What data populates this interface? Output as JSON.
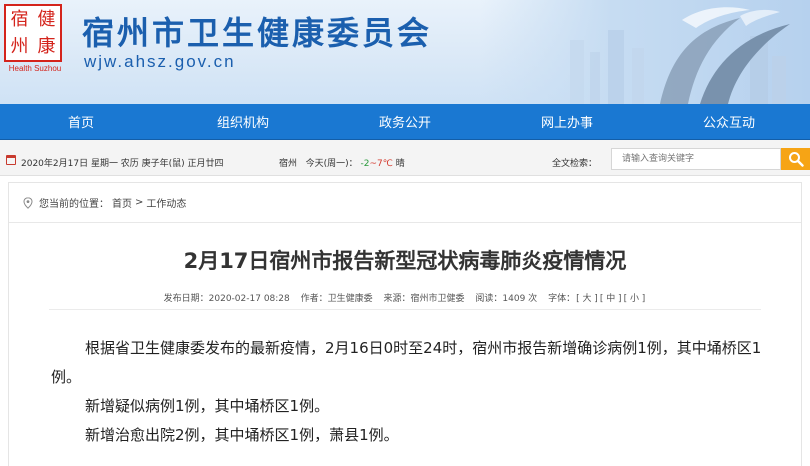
{
  "header": {
    "logo_chars": [
      "宿",
      "健",
      "州",
      "康"
    ],
    "logo_en": "Health Suzhou",
    "title": "宿州市卫生健康委员会",
    "url": "wjw.ahsz.gov.cn"
  },
  "nav": {
    "items": [
      {
        "label": "首页"
      },
      {
        "label": "组织机构"
      },
      {
        "label": "政务公开"
      },
      {
        "label": "网上办事"
      },
      {
        "label": "公众互动"
      }
    ]
  },
  "infobar": {
    "date": "2020年2月17日 星期一 农历 庚子年(鼠) 正月廿四",
    "weather_city": "宿州",
    "weather_label": "今天(周一)：",
    "weather_temp_lo": "-2",
    "weather_temp_hi": "~7℃",
    "weather_cond": "晴",
    "search_label": "全文检索：",
    "search_placeholder": "请输入查询关键字"
  },
  "breadcrumb": {
    "prefix": "您当前的位置：",
    "home": "首页",
    "sep": ">",
    "current": "工作动态"
  },
  "article": {
    "title": "2月17日宿州市报告新型冠状病毒肺炎疫情情况",
    "publish_date": "发布日期：2020-02-17 08:28",
    "author": "作者：卫生健康委",
    "source": "来源：宿州市卫健委",
    "views": "阅读：1409 次",
    "font_label": "字体：",
    "font_large": "[ 大 ]",
    "font_medium": "[ 中 ]",
    "font_small": "[ 小 ]",
    "paragraphs": [
      "根据省卫生健康委发布的最新疫情，2月16日0时至24时，宿州市报告新增确诊病例1例，其中埇桥区1例。",
      "新增疑似病例1例，其中埇桥区1例。",
      "新增治愈出院2例，其中埇桥区1例，萧县1例。"
    ]
  },
  "colors": {
    "brand_blue": "#1b5fae",
    "nav_blue": "#1a78d2",
    "logo_red": "#d4241c",
    "search_button": "#f6a415"
  }
}
